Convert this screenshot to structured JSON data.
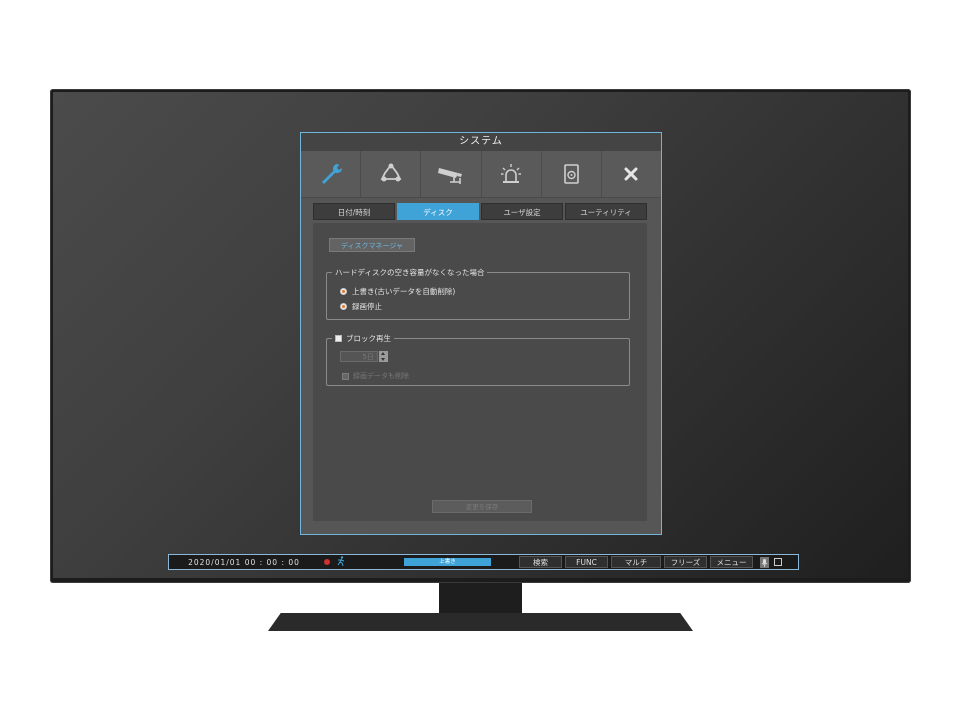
{
  "dialog": {
    "title": "システム",
    "icons": [
      "wrench-icon",
      "network-icon",
      "camera-icon",
      "alarm-icon",
      "disk-icon",
      "close-icon"
    ],
    "tabs": [
      {
        "label": "日付/時刻",
        "active": false
      },
      {
        "label": "ディスク",
        "active": true
      },
      {
        "label": "ユーザ設定",
        "active": false
      },
      {
        "label": "ユーティリティ",
        "active": false
      }
    ],
    "disk_manager_label": "ディスクマネージャ",
    "full_disk_group": {
      "legend": "ハードディスクの空き容量がなくなった場合",
      "options": [
        {
          "label": "上書き(古いデータを自動削除)",
          "selected": true
        },
        {
          "label": "録画停止",
          "selected": false
        }
      ]
    },
    "block_play_group": {
      "legend": "ブロック再生",
      "checked": false,
      "days_value": "5日",
      "delete_label": "録画データも削除",
      "delete_checked": false
    },
    "save_label": "変更を保存"
  },
  "statusbar": {
    "datetime": "2020/01/01  00 : 00 : 00",
    "progress_label": "上書き",
    "buttons": [
      "検索",
      "FUNC",
      "マルチ",
      "フリーズ",
      "メニュー"
    ]
  },
  "colors": {
    "accent": "#3fa3d8",
    "record": "#d03030"
  }
}
